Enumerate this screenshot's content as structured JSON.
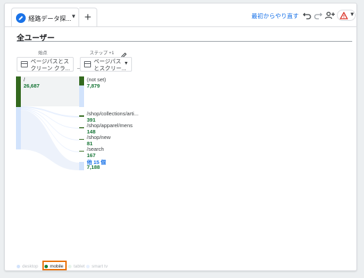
{
  "tab": {
    "label": "経路データ探...",
    "icon": "pencil-icon"
  },
  "toolbar": {
    "add_tab": "+",
    "restart_label": "最初からやり直す",
    "icons": [
      "undo-icon",
      "redo-icon",
      "share-icon",
      "warning-icon"
    ]
  },
  "segment": {
    "title": "全ユーザー"
  },
  "steps": {
    "start_label": "始点",
    "next_label": "ステップ +1"
  },
  "dimensions": {
    "start": [
      "ページパスとス",
      "クリーン クラ..."
    ],
    "next": [
      "ページパス",
      "とスクリー..."
    ]
  },
  "start_node": {
    "label": "/",
    "value": "26,687"
  },
  "next_nodes": [
    {
      "label": "(not set)",
      "value": "7,879"
    },
    {
      "label": "/shop/collections/arti...",
      "value": "391"
    },
    {
      "label": "/shop/apparel/mens",
      "value": "148"
    },
    {
      "label": "/shop/new",
      "value": "81"
    },
    {
      "label": "/search",
      "value": "167"
    }
  ],
  "more": {
    "label": "他 15 個",
    "value": "7,188"
  },
  "legend": {
    "items": [
      "desktop",
      "mobile",
      "tablet",
      "smart tv"
    ],
    "active": "mobile"
  },
  "colors": {
    "accent": "#1a73e8",
    "node_dark": "#33691e",
    "node_light": "#d2e3fc",
    "value_green": "#137333",
    "highlight": "#e8710a"
  }
}
